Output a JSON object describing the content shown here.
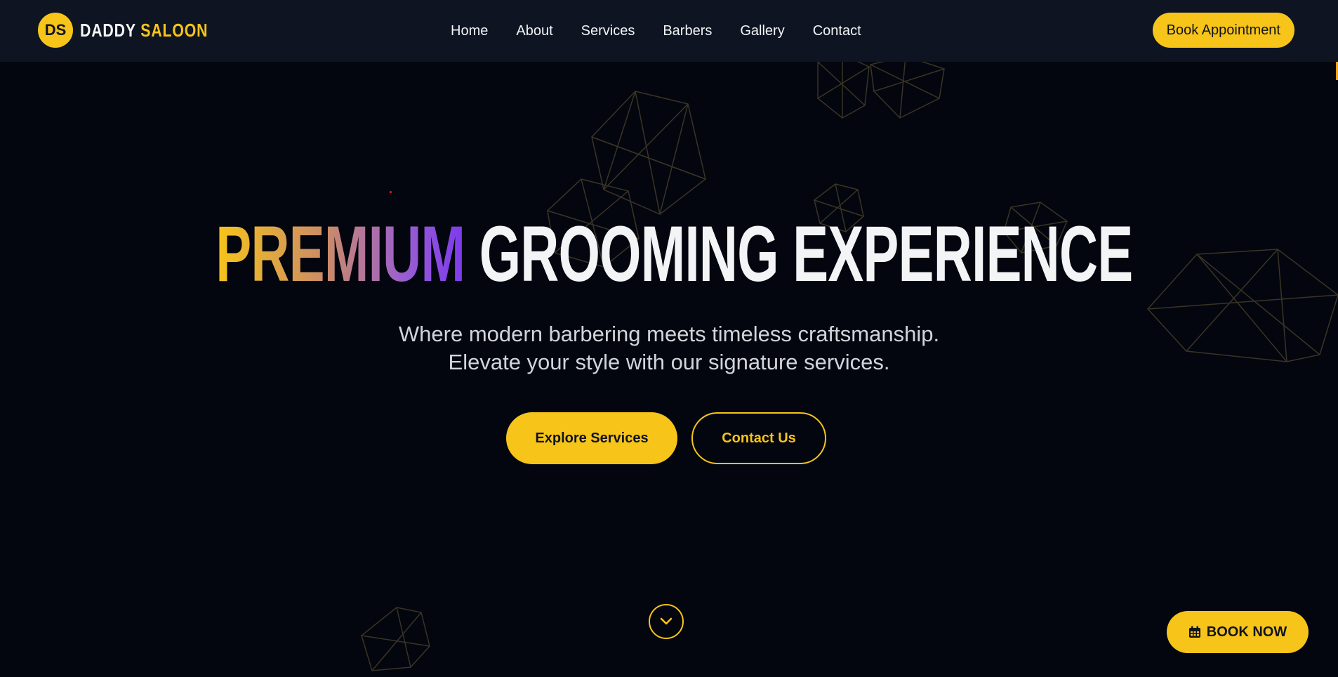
{
  "brand": {
    "badge": "DS",
    "name_part1": "DADDY",
    "name_part2": "SALOON"
  },
  "nav": {
    "items": [
      {
        "label": "Home"
      },
      {
        "label": "About"
      },
      {
        "label": "Services"
      },
      {
        "label": "Barbers"
      },
      {
        "label": "Gallery"
      },
      {
        "label": "Contact"
      }
    ],
    "cta_label": "Book Appointment"
  },
  "hero": {
    "title_highlight": "PREMIUM",
    "title_rest": "GROOMING EXPERIENCE",
    "subtitle_line1": "Where modern barbering meets timeless craftsmanship.",
    "subtitle_line2": "Elevate your style with our signature services.",
    "primary_button": "Explore Services",
    "secondary_button": "Contact Us"
  },
  "floating_cta": {
    "label": "BOOK NOW",
    "icon": "calendar-icon"
  },
  "scroll_indicator": {
    "icon": "chevron-down-icon"
  },
  "colors": {
    "background": "#03060e",
    "navbar": "#0e1422",
    "accent": "#f7c41a",
    "gradient_end": "#7b3aed",
    "text": "#f3f4f6"
  }
}
